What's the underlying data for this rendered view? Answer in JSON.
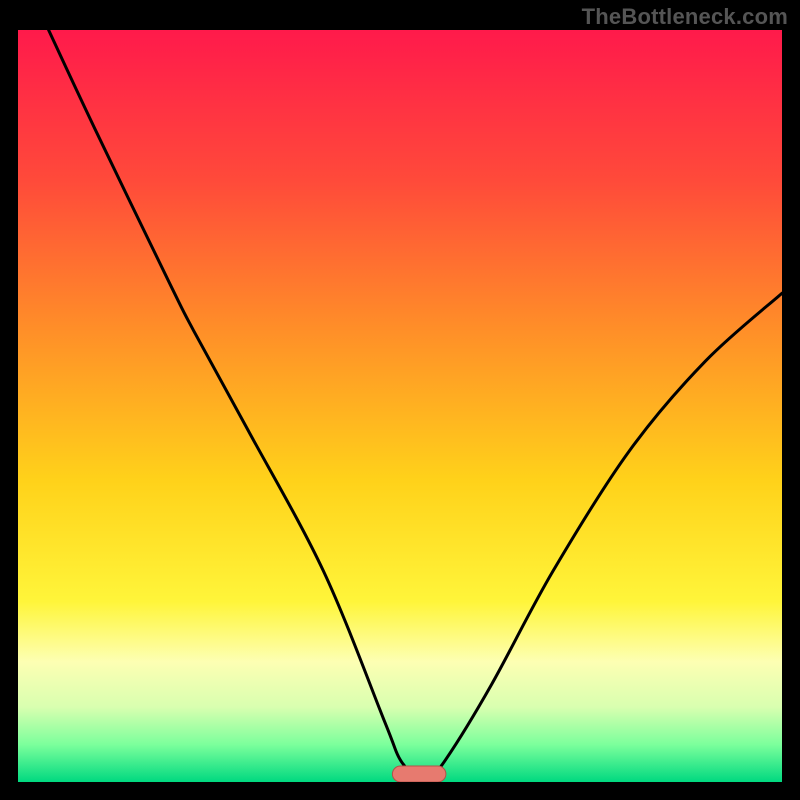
{
  "watermark": "TheBottleneck.com",
  "chart_data": {
    "type": "line",
    "title": "",
    "xlabel": "",
    "ylabel": "",
    "xlim": [
      0,
      100
    ],
    "ylim": [
      0,
      100
    ],
    "background_gradient": {
      "stops": [
        {
          "offset": 0.0,
          "color": "#ff1a4b"
        },
        {
          "offset": 0.2,
          "color": "#ff4a3a"
        },
        {
          "offset": 0.4,
          "color": "#ff8f28"
        },
        {
          "offset": 0.6,
          "color": "#ffd21a"
        },
        {
          "offset": 0.76,
          "color": "#fff53a"
        },
        {
          "offset": 0.84,
          "color": "#fdffb3"
        },
        {
          "offset": 0.9,
          "color": "#d9ffb0"
        },
        {
          "offset": 0.95,
          "color": "#7cff9c"
        },
        {
          "offset": 1.0,
          "color": "#00d980"
        }
      ]
    },
    "series": [
      {
        "name": "bottleneck-curve",
        "x": [
          4,
          10,
          20,
          23,
          30,
          40,
          48,
          50,
          52,
          54,
          56,
          62,
          70,
          80,
          90,
          100
        ],
        "y": [
          100,
          87,
          66,
          60,
          47,
          28,
          8,
          3,
          1,
          1,
          3,
          13,
          28,
          44,
          56,
          65
        ]
      }
    ],
    "marker": {
      "name": "optimal-pill",
      "x_center": 52.5,
      "width_pct": 7,
      "fill": "#e77a6f",
      "stroke": "#b45148"
    }
  }
}
